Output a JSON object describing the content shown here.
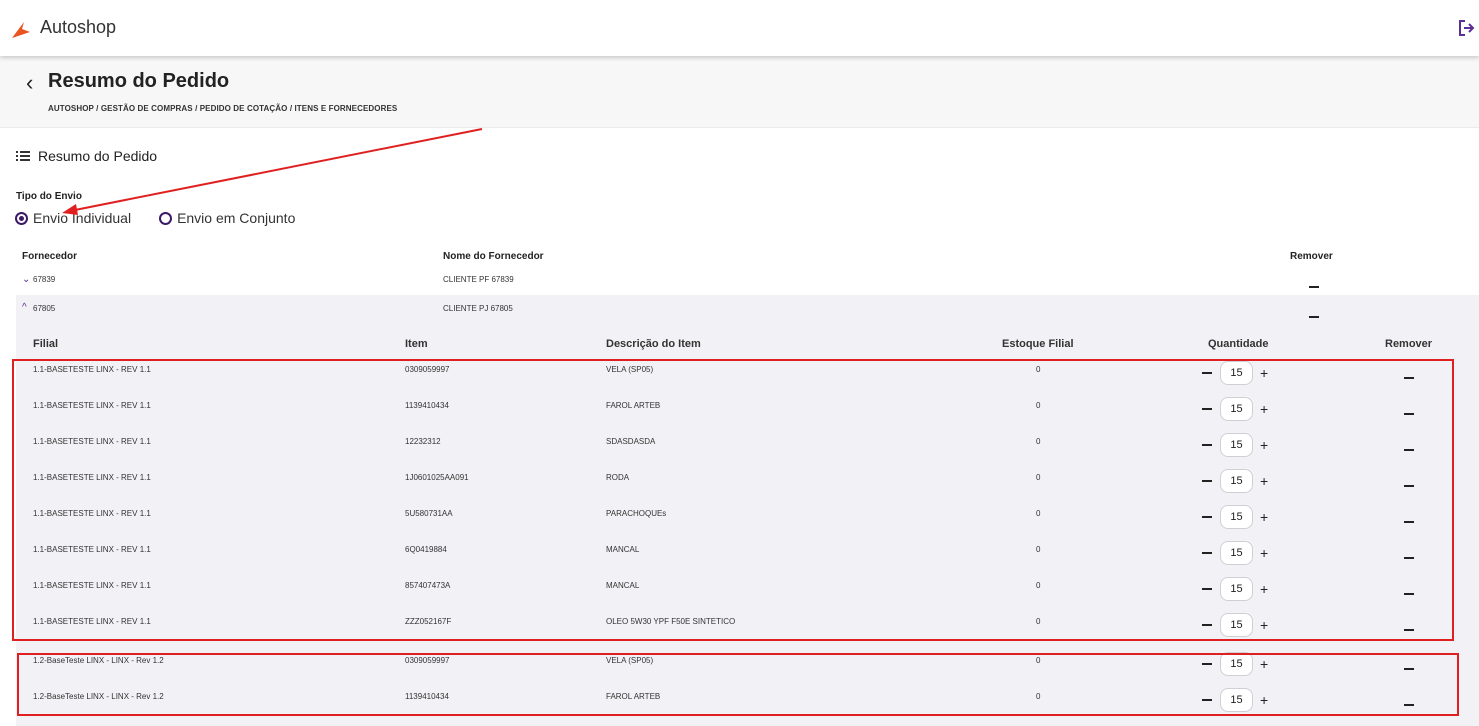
{
  "app": {
    "title": "Autoshop"
  },
  "page": {
    "title": "Resumo do Pedido",
    "breadcrumb": "AUTOSHOP / GESTÃO DE COMPRAS / PEDIDO DE COTAÇÃO / ITENS E FORNECEDORES"
  },
  "section": {
    "title": "Resumo do Pedido"
  },
  "envio": {
    "label": "Tipo do Envio",
    "options": [
      {
        "label": "Envio Individual",
        "checked": true
      },
      {
        "label": "Envio em Conjunto",
        "checked": false
      }
    ]
  },
  "suppliers_table": {
    "headers": {
      "fornecedor": "Fornecedor",
      "nome": "Nome do Fornecedor",
      "remover": "Remover"
    },
    "rows": [
      {
        "code": "67839",
        "name": "CLIENTE PF 67839",
        "expanded": false
      },
      {
        "code": "67805",
        "name": "CLIENTE PJ 67805",
        "expanded": true
      }
    ]
  },
  "items_table": {
    "headers": {
      "filial": "Filial",
      "item": "Item",
      "descricao": "Descrição do Item",
      "estoque": "Estoque Filial",
      "quantidade": "Quantidade",
      "remover": "Remover"
    },
    "rows": [
      {
        "filial": "1.1-BASETESTE LINX - REV 1.1",
        "item": "0309059997",
        "descricao": "VELA (SP05)",
        "estoque": "0",
        "quantidade": "15"
      },
      {
        "filial": "1.1-BASETESTE LINX - REV 1.1",
        "item": "1139410434",
        "descricao": "FAROL ARTEB",
        "estoque": "0",
        "quantidade": "15"
      },
      {
        "filial": "1.1-BASETESTE LINX - REV 1.1",
        "item": "12232312",
        "descricao": "SDASDASDA",
        "estoque": "0",
        "quantidade": "15"
      },
      {
        "filial": "1.1-BASETESTE LINX - REV 1.1",
        "item": "1J0601025AA091",
        "descricao": "RODA",
        "estoque": "0",
        "quantidade": "15"
      },
      {
        "filial": "1.1-BASETESTE LINX - REV 1.1",
        "item": "5U580731AA",
        "descricao": "PARACHOQUEs",
        "estoque": "0",
        "quantidade": "15"
      },
      {
        "filial": "1.1-BASETESTE LINX - REV 1.1",
        "item": "6Q0419884",
        "descricao": "MANCAL",
        "estoque": "0",
        "quantidade": "15"
      },
      {
        "filial": "1.1-BASETESTE LINX - REV 1.1",
        "item": "857407473A",
        "descricao": "MANCAL",
        "estoque": "0",
        "quantidade": "15"
      },
      {
        "filial": "1.1-BASETESTE LINX - REV 1.1",
        "item": "ZZZ052167F",
        "descricao": "OLEO 5W30 YPF F50E SINTETICO",
        "estoque": "0",
        "quantidade": "15"
      },
      {
        "filial": "1.2-BaseTeste LINX - LINX - Rev 1.2",
        "item": "0309059997",
        "descricao": "VELA (SP05)",
        "estoque": "0",
        "quantidade": "15"
      },
      {
        "filial": "1.2-BaseTeste LINX - LINX - Rev 1.2",
        "item": "1139410434",
        "descricao": "FAROL ARTEB",
        "estoque": "0",
        "quantidade": "15"
      }
    ]
  },
  "colors": {
    "accent": "#3d1a66",
    "annotation": "#e02020",
    "logo": "#e8531f"
  }
}
